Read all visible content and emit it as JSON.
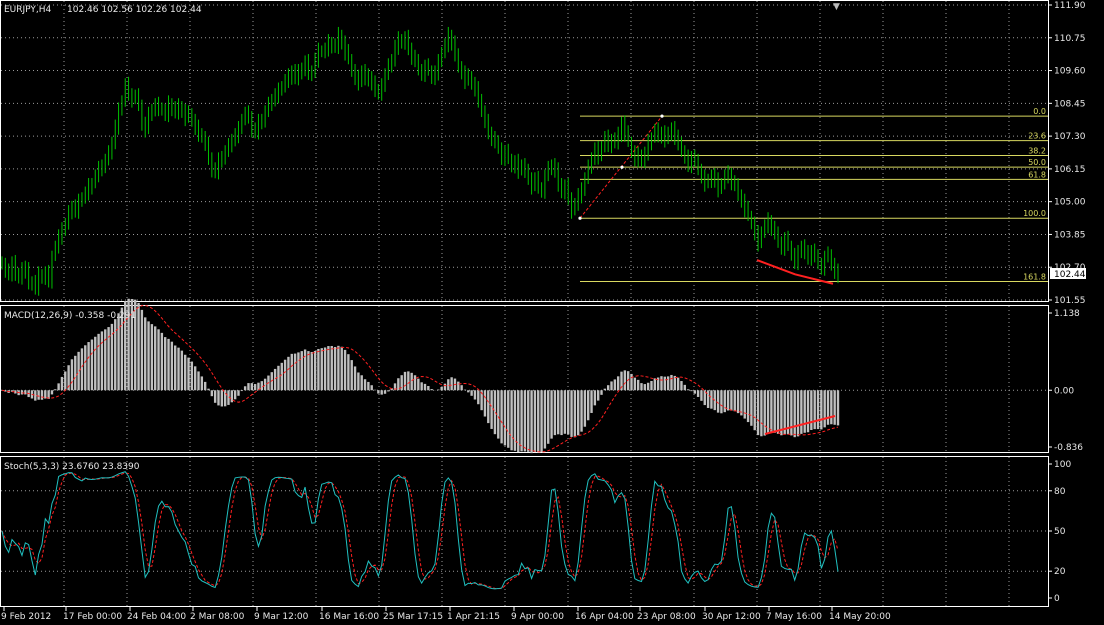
{
  "chart_data": [
    {
      "type": "candlestick",
      "title": "EURJPY,H4",
      "ohlc_header": "102.46 102.56 102.26 102.44",
      "y_ticks": [
        "111.90",
        "110.75",
        "109.60",
        "108.45",
        "107.30",
        "106.15",
        "105.00",
        "103.85",
        "102.70",
        "101.55"
      ],
      "ylim": [
        101.55,
        111.9
      ],
      "current_price": "102.44",
      "grid": true,
      "color": "#00c000",
      "series": [
        {
          "close": [
            102.8,
            102.55,
            102.5,
            102.9,
            102.4,
            102.35,
            102.7,
            102.6,
            102.1,
            102.2,
            102.0,
            102.45,
            102.3,
            102.5,
            102.25,
            103.1,
            103.4,
            103.75,
            104.1,
            104.2,
            104.6,
            104.85,
            104.7,
            105.0,
            105.15,
            105.3,
            105.55,
            105.65,
            105.9,
            106.15,
            106.3,
            106.45,
            106.7,
            107.1,
            107.65,
            108.2,
            108.55,
            109.1,
            108.8,
            108.6,
            108.7,
            108.4,
            107.75,
            107.55,
            108.05,
            108.25,
            108.4,
            108.3,
            108.2,
            108.05,
            108.45,
            108.3,
            108.1,
            108.35,
            108.2,
            107.95,
            108.1,
            107.85,
            107.6,
            107.4,
            107.25,
            107.0,
            106.55,
            106.15,
            106.0,
            106.45,
            106.6,
            106.75,
            106.95,
            107.2,
            107.35,
            107.55,
            107.9,
            108.1,
            108.0,
            107.55,
            107.4,
            107.8,
            107.9,
            108.15,
            108.4,
            108.6,
            108.75,
            108.9,
            109.05,
            109.25,
            109.4,
            109.6,
            109.3,
            109.55,
            109.7,
            109.9,
            109.45,
            109.6,
            110.0,
            110.3,
            110.25,
            110.35,
            110.6,
            110.5,
            110.4,
            110.85,
            110.6,
            110.25,
            110.0,
            109.6,
            109.35,
            109.2,
            109.6,
            109.3,
            109.4,
            109.2,
            108.85,
            108.8,
            109.15,
            109.45,
            109.75,
            110.0,
            110.45,
            110.7,
            110.55,
            110.75,
            110.4,
            110.1,
            109.9,
            109.65,
            109.5,
            109.75,
            109.6,
            109.35,
            109.55,
            109.9,
            110.25,
            110.5,
            110.85,
            110.6,
            110.1,
            109.75,
            109.55,
            109.25,
            109.4,
            109.15,
            108.95,
            108.6,
            108.15,
            107.8,
            107.45,
            107.25,
            107.05,
            106.9,
            106.55,
            106.75,
            106.5,
            106.25,
            106.4,
            106.1,
            106.3,
            106.05,
            105.85,
            105.55,
            105.8,
            105.5,
            105.4,
            105.9,
            106.15,
            106.3,
            106.1,
            105.65,
            105.3,
            105.55,
            105.15,
            104.7,
            104.9,
            105.2,
            105.5,
            105.8,
            106.2,
            106.55,
            106.85,
            106.6,
            106.95,
            107.25,
            107.0,
            107.2,
            107.05,
            107.35,
            107.8,
            107.4,
            107.1,
            106.75,
            106.5,
            106.65,
            106.4,
            106.7,
            107.1,
            107.25,
            107.5,
            107.3,
            107.45,
            107.2,
            107.35,
            107.6,
            107.25,
            107.1,
            106.75,
            106.55,
            106.3,
            106.6,
            106.4,
            106.15,
            105.9,
            105.65,
            105.7,
            105.95,
            105.75,
            105.45,
            105.65,
            105.9,
            106.0,
            105.7,
            105.55,
            105.25,
            105.05,
            104.75,
            104.5,
            104.25,
            103.9,
            103.55,
            103.95,
            104.15,
            104.35,
            104.1,
            103.85,
            103.6,
            103.4,
            103.7,
            103.45,
            103.15,
            102.9,
            103.2,
            103.45,
            103.2,
            103.05,
            103.3,
            103.05,
            102.85,
            102.7,
            103.05,
            103.15,
            102.8,
            102.55,
            102.44
          ],
          "start_close": 102.9
        }
      ],
      "fibonacci": [
        {
          "label": "0.0",
          "value": 108.0
        },
        {
          "label": "23.6",
          "value": 107.14
        },
        {
          "label": "38.2",
          "value": 106.62
        },
        {
          "label": "50.0",
          "value": 106.21
        },
        {
          "label": "61.8",
          "value": 105.78
        },
        {
          "label": "100.0",
          "value": 104.42
        },
        {
          "label": "161.8",
          "value": 102.2
        }
      ],
      "trendline_color": "#ff2020"
    },
    {
      "type": "bar",
      "title": "MACD(12,26,9) -0.358 -0.291",
      "y_ticks": [
        "1.138",
        "0.00",
        "-0.836"
      ],
      "ylim": [
        -0.836,
        1.138
      ],
      "histogram_color": "#c0c0c0",
      "signal_color": "#ff2020",
      "series": [
        {
          "name": "MACD",
          "values": []
        },
        {
          "name": "Signal",
          "values": []
        }
      ]
    },
    {
      "type": "line",
      "title": "Stoch(5,3,3) 23.6760 23.8390",
      "y_ticks": [
        "100",
        "80",
        "50",
        "20",
        "0"
      ],
      "ylim": [
        0,
        100
      ],
      "series": [
        {
          "name": "Main",
          "color": "#20c0c0"
        },
        {
          "name": "Signal",
          "color": "#ff2020"
        }
      ]
    }
  ],
  "x_ticks": [
    "9 Feb 2012",
    "17 Feb 00:00",
    "24 Feb 04:00",
    "2 Mar 08:00",
    "9 Mar 12:00",
    "16 Mar 16:00",
    "25 Mar 17:15",
    "1 Apr 21:15",
    "9 Apr 00:00",
    "16 Apr 04:00",
    "23 Apr 08:00",
    "30 Apr 12:00",
    "7 May 16:00",
    "14 May 20:00"
  ],
  "colors": {
    "background": "#000000",
    "frame": "#ffffff",
    "grid": "#9a9a9a",
    "fib": "#d8d860",
    "bull": "#00c000"
  }
}
